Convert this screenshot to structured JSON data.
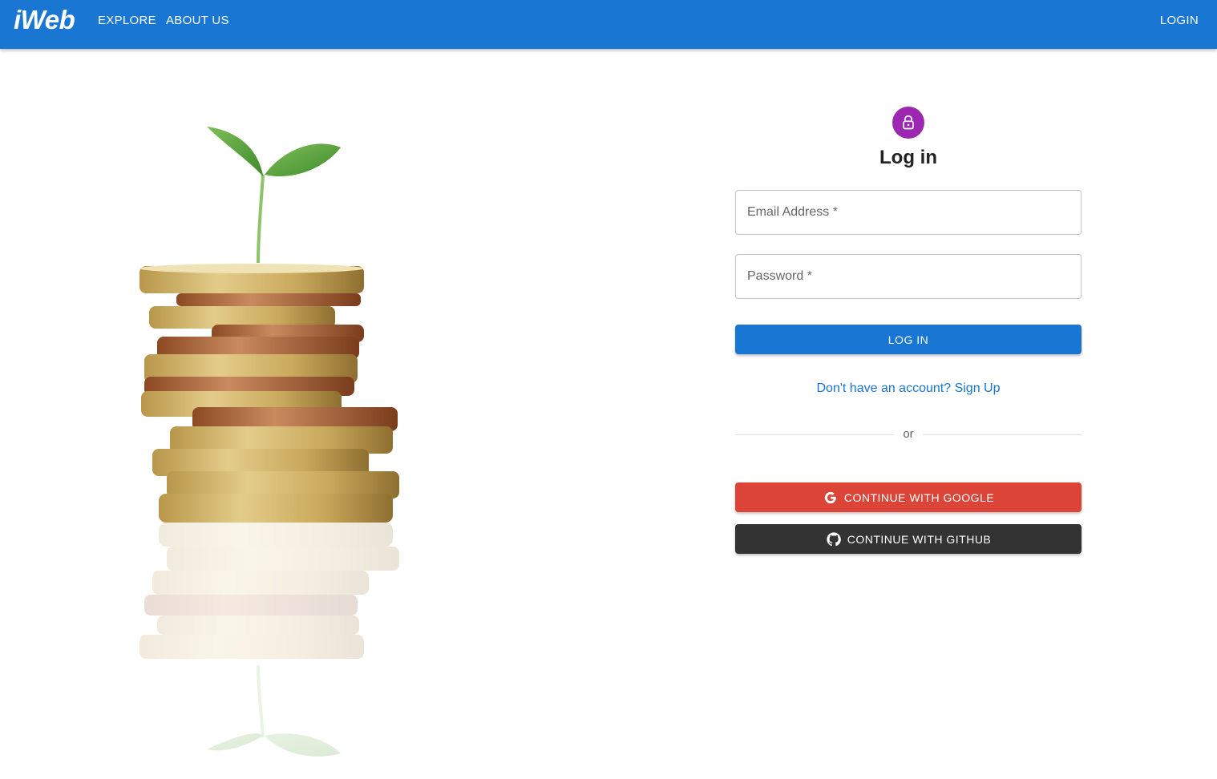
{
  "appbar": {
    "brand": "iWeb",
    "nav": {
      "explore": "EXPLORE",
      "about": "ABOUT US",
      "login": "LOGIN"
    },
    "color": "#1976d2"
  },
  "hero": {
    "icon": "coin-stack-sprout-illustration"
  },
  "login": {
    "avatar_icon": "lock-icon",
    "avatar_color": "#9c27b0",
    "title": "Log in",
    "email": {
      "placeholder": "Email Address *",
      "value": ""
    },
    "password": {
      "placeholder": "Password *",
      "value": ""
    },
    "submit_label": "LOG IN",
    "signup_link": "Don't have an account? Sign Up",
    "divider_text": "or",
    "google_label": "CONTINUE WITH GOOGLE",
    "google_icon": "google-icon",
    "google_color": "#db4437",
    "github_label": "CONTINUE WITH GITHUB",
    "github_icon": "github-icon",
    "github_color": "#333333"
  }
}
